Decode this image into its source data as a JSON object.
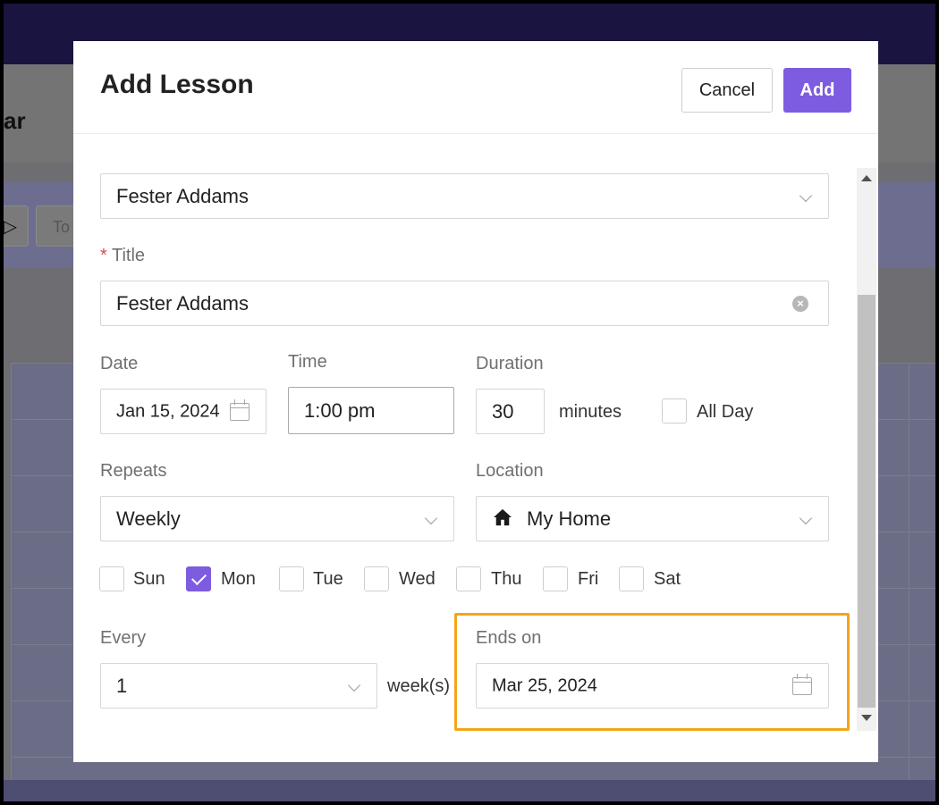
{
  "background": {
    "header_title_partial": "ar",
    "toolbar_today_partial": "To"
  },
  "modal": {
    "title": "Add Lesson",
    "cancel_label": "Cancel",
    "add_label": "Add"
  },
  "form": {
    "student": {
      "value": "Fester Addams"
    },
    "title": {
      "required_mark": "*",
      "label": "Title",
      "value": "Fester Addams"
    },
    "date": {
      "label": "Date",
      "value": "Jan 15, 2024"
    },
    "time": {
      "label": "Time",
      "value": "1:00 pm"
    },
    "duration": {
      "label": "Duration",
      "value": "30",
      "unit": "minutes"
    },
    "all_day": {
      "label": "All Day",
      "checked": false
    },
    "repeats": {
      "label": "Repeats",
      "value": "Weekly"
    },
    "location": {
      "label": "Location",
      "value": "My Home",
      "icon": "home-icon"
    },
    "weekdays": [
      {
        "label": "Sun",
        "checked": false
      },
      {
        "label": "Mon",
        "checked": true
      },
      {
        "label": "Tue",
        "checked": false
      },
      {
        "label": "Wed",
        "checked": false
      },
      {
        "label": "Thu",
        "checked": false
      },
      {
        "label": "Fri",
        "checked": false
      },
      {
        "label": "Sat",
        "checked": false
      }
    ],
    "every": {
      "label": "Every",
      "value": "1",
      "unit": "week(s)"
    },
    "ends_on": {
      "label": "Ends on",
      "value": "Mar 25, 2024"
    }
  },
  "colors": {
    "accent": "#7d5ce0",
    "highlight": "#f2a51a"
  }
}
